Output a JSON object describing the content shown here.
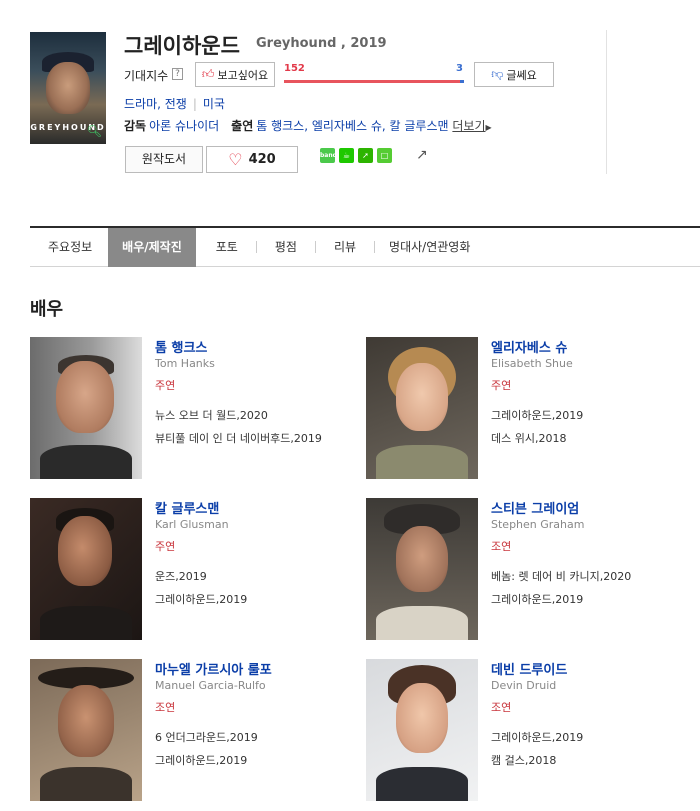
{
  "movie": {
    "title_ko": "그레이하운드",
    "title_en": "Greyhound , 2019",
    "poster_text": "GREYHOUND",
    "expect_label": "기대지수",
    "help_mark": "?",
    "want_label": "보고싶어요",
    "want_count": "152",
    "meh_count": "3",
    "meh_label": "글쎄요",
    "want_ratio": 0.98,
    "genre": "드라마, 전쟁",
    "country": "미국",
    "director_label": "감독",
    "director": "아론 슈나이더",
    "cast_label": "출연",
    "cast": "톰 행크스, 엘리자베스 슈, 칼 글루스맨",
    "more_label": "더보기",
    "original_book_label": "원작도서",
    "like_count": "420"
  },
  "share_icons": [
    "band-icon",
    "cafe-icon",
    "blog-icon",
    "memo-icon",
    "share-icon"
  ],
  "tabs": [
    "주요정보",
    "배우/제작진",
    "포토",
    "평점",
    "리뷰",
    "명대사/연관영화"
  ],
  "active_tab": "배우/제작진",
  "section_title": "배우",
  "actors": [
    {
      "name": "톰 행크스",
      "name_en": "Tom Hanks",
      "role": "주연",
      "works": [
        "뉴스 오브 더 월드,2020",
        "뷰티풀 데이 인 더 네이버후드,2019"
      ]
    },
    {
      "name": "엘리자베스 슈",
      "name_en": "Elisabeth Shue",
      "role": "주연",
      "works": [
        "그레이하운드,2019",
        "데스 위시,2018"
      ]
    },
    {
      "name": "칼 글루스맨",
      "name_en": "Karl Glusman",
      "role": "주연",
      "works": [
        "운즈,2019",
        "그레이하운드,2019"
      ]
    },
    {
      "name": "스티븐 그레이엄",
      "name_en": "Stephen Graham",
      "role": "조연",
      "works": [
        "베놈: 렛 데어 비 카니지,2020",
        "그레이하운드,2019"
      ]
    },
    {
      "name": "마누엘 가르시아 룰포",
      "name_en": "Manuel Garcia-Rulfo",
      "role": "조연",
      "works": [
        "6 언더그라운드,2019",
        "그레이하운드,2019"
      ]
    },
    {
      "name": "데빈 드루이드",
      "name_en": "Devin Druid",
      "role": "조연",
      "works": [
        "그레이하운드,2019",
        "캠 걸스,2018"
      ]
    }
  ],
  "colors": {
    "accent_blue": "#0b3ea8",
    "role_red": "#c8343b",
    "like_red": "#e23a4a",
    "meh_blue": "#3b6fd0",
    "active_tab_bg": "#898989"
  }
}
